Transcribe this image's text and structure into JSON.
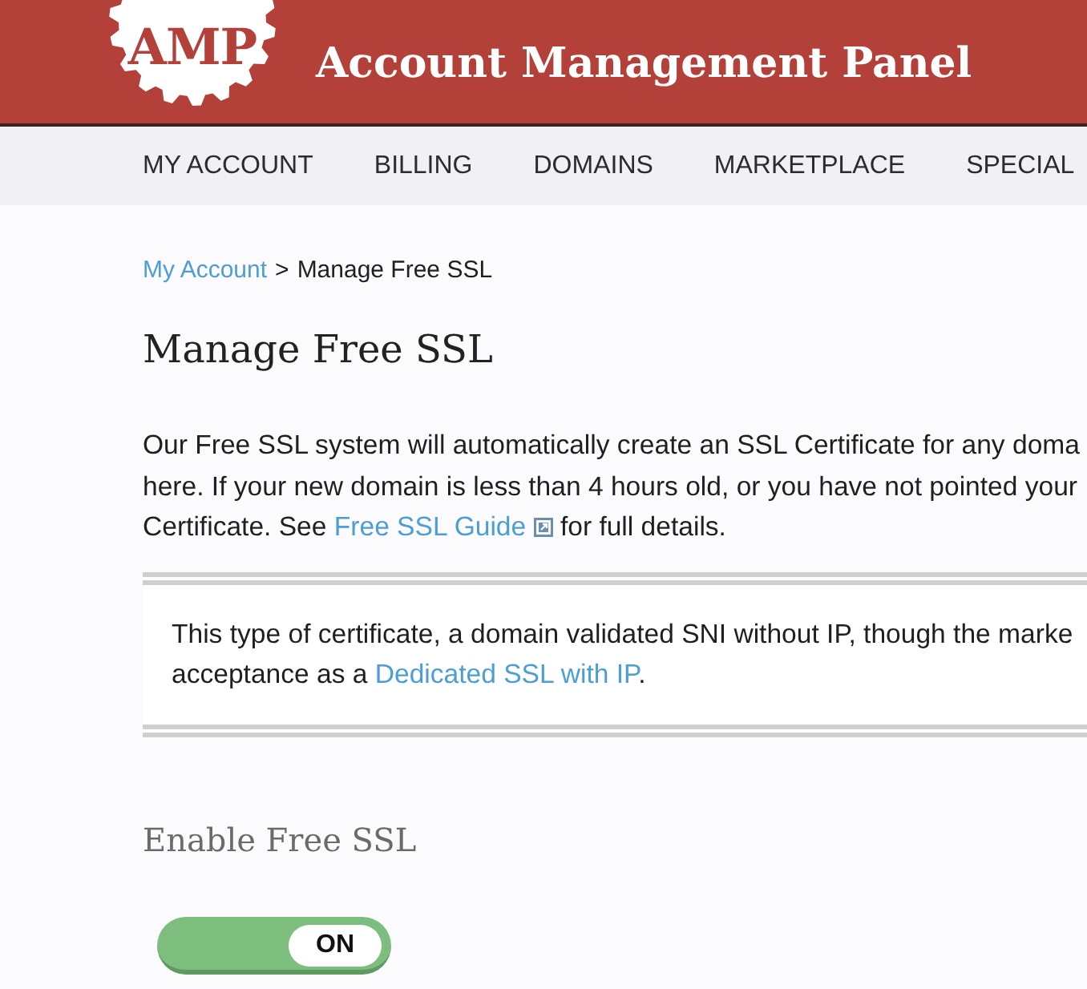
{
  "header": {
    "logo_text": "AMP",
    "title": "Account Management Panel"
  },
  "nav": {
    "items": [
      {
        "label": "MY ACCOUNT"
      },
      {
        "label": "BILLING"
      },
      {
        "label": "DOMAINS"
      },
      {
        "label": "MARKETPLACE"
      },
      {
        "label": "SPECIAL"
      }
    ]
  },
  "breadcrumb": {
    "items": [
      {
        "kind": "link",
        "label": "My Account"
      },
      {
        "kind": "separator",
        "label": ">"
      },
      {
        "kind": "current",
        "label": "Manage Free SSL"
      }
    ]
  },
  "page_title": "Manage Free SSL",
  "intro": {
    "lines": [
      [
        {
          "kind": "text",
          "text": "Our Free SSL system will automatically create an SSL Certificate for any doma"
        }
      ],
      [
        {
          "kind": "text",
          "text": "here. If your new domain is less than 4 hours old, or you have not pointed your"
        }
      ],
      [
        {
          "kind": "text",
          "text": "Certificate. See "
        },
        {
          "kind": "link",
          "text": "Free SSL Guide",
          "external": true
        },
        {
          "kind": "text",
          "text": " for full details."
        }
      ]
    ]
  },
  "note": {
    "lines": [
      [
        {
          "kind": "text",
          "text": "This type of certificate, a domain validated SNI without IP, though the marke"
        }
      ],
      [
        {
          "kind": "text",
          "text": "acceptance as a "
        },
        {
          "kind": "link",
          "text": "Dedicated SSL with IP"
        },
        {
          "kind": "text",
          "text": "."
        }
      ]
    ]
  },
  "section_title": "Enable Free SSL",
  "ssl_toggle": {
    "on": true,
    "label": "ON"
  }
}
